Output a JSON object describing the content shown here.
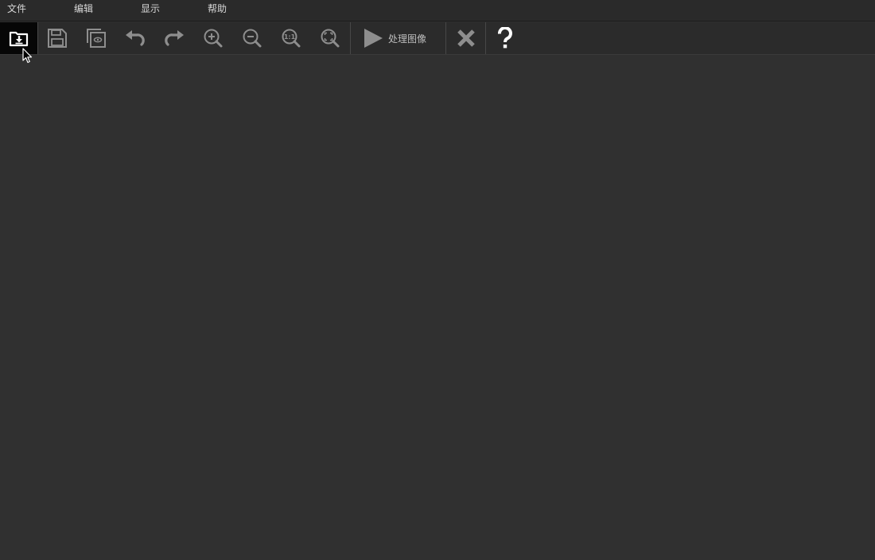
{
  "menu": {
    "items": [
      {
        "id": "file",
        "label": "文件"
      },
      {
        "id": "edit",
        "label": "编辑"
      },
      {
        "id": "view",
        "label": "显示"
      },
      {
        "id": "help",
        "label": "帮助"
      }
    ]
  },
  "toolbar": {
    "buttons": [
      {
        "id": "open",
        "icon": "folder-download-icon",
        "active": true
      },
      {
        "id": "save",
        "icon": "save-disk-icon"
      },
      {
        "id": "preview",
        "icon": "copy-preview-icon"
      },
      {
        "id": "undo",
        "icon": "undo-icon"
      },
      {
        "id": "redo",
        "icon": "redo-icon"
      },
      {
        "id": "zoom_in",
        "icon": "zoom-in-icon"
      },
      {
        "id": "zoom_out",
        "icon": "zoom-out-icon"
      },
      {
        "id": "zoom_actual",
        "icon": "zoom-actual-size-icon"
      },
      {
        "id": "zoom_fit",
        "icon": "zoom-fit-icon"
      },
      {
        "id": "process",
        "icon": "play-icon"
      },
      {
        "id": "close",
        "icon": "close-x-icon"
      },
      {
        "id": "help",
        "icon": "question-icon"
      }
    ],
    "process_label": "处理图像",
    "zoom_actual_text": "1:1"
  },
  "colors": {
    "background": "#303030",
    "toolbar": "#2b2b2b",
    "icon": "#8e8e8e",
    "icon_bright": "#ffffff",
    "active_button": "#060606"
  }
}
